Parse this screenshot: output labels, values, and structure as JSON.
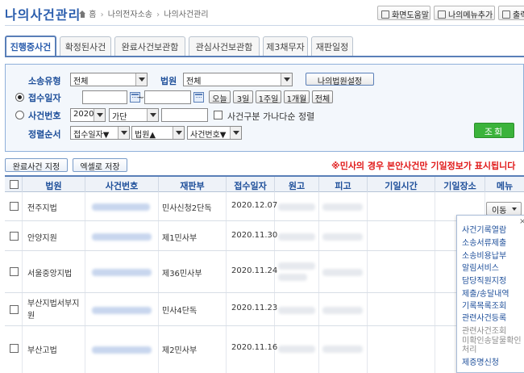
{
  "header": {
    "title": "나의사건관리",
    "breadcrumb": [
      "홈",
      "나의전자소송",
      "나의사건관리"
    ],
    "buttons": {
      "help": "화면도움말",
      "add_menu": "나의메뉴추가",
      "print": "출력"
    }
  },
  "tabs": [
    {
      "label": "진행중사건",
      "active": true
    },
    {
      "label": "확정된사건",
      "active": false
    },
    {
      "label": "완료사건보관함",
      "active": false
    },
    {
      "label": "관심사건보관함",
      "active": false
    },
    {
      "label": "제3채무자",
      "active": false
    },
    {
      "label": "재판일정",
      "active": false
    }
  ],
  "search": {
    "type_label": "소송유형",
    "type_value": "전체",
    "court_label": "법원",
    "court_value": "전체",
    "court_setting_button": "나의법원설정",
    "date_label": "접수일자",
    "date_from": "",
    "date_to": "",
    "date_range_sep": "~",
    "date_buttons": [
      "오늘",
      "3일",
      "1주일",
      "1개월",
      "전체"
    ],
    "case_label": "사건번호",
    "case_year": "2020",
    "case_type": "가단",
    "case_number": "",
    "multi_case_label": "사건구분 가나다순 정렬",
    "sort_label": "정렬순서",
    "sort_options": [
      "접수일자▼",
      "법원▲",
      "사건번호▼"
    ],
    "search_button": "조회"
  },
  "actions": {
    "complete_button": "완료사건 지정",
    "excel_button": "엑셀로 저장",
    "notice": "※민사의 경우 본안사건만 기일정보가 표시됩니다"
  },
  "table": {
    "headers": [
      "법원",
      "사건번호",
      "재판부",
      "접수일자",
      "원고",
      "피고",
      "기일시간",
      "기일장소",
      "메뉴"
    ],
    "rows": [
      {
        "court": "전주지법",
        "division": "민사신청2단독",
        "date": "2020.12.07"
      },
      {
        "court": "안양지원",
        "division": "제1민사부",
        "date": "2020.11.30"
      },
      {
        "court": "서울중앙지법",
        "division": "제36민사부",
        "date": "2020.11.24"
      },
      {
        "court": "부산지법서부지원",
        "division": "민사4단독",
        "date": "2020.11.23"
      },
      {
        "court": "부산고법",
        "division": "제2민사부",
        "date": "2020.11.16"
      }
    ],
    "move_button": "이동"
  },
  "popup_menu": {
    "close": "×",
    "items": [
      {
        "label": "사건기록열람",
        "enabled": true
      },
      {
        "label": "소송서류제출",
        "enabled": true
      },
      {
        "label": "소송비용납부",
        "enabled": true
      },
      {
        "label": "알림서비스",
        "enabled": true
      },
      {
        "label": "담당직원지정",
        "enabled": true
      },
      {
        "label": "제출/송달내역",
        "enabled": true
      },
      {
        "label": "기록목록조회",
        "enabled": true
      },
      {
        "label": "관련사건등록",
        "enabled": true
      },
      {
        "label": "관련사건조회",
        "enabled": false
      },
      {
        "label": "미확인송달물확인처리",
        "enabled": false
      },
      {
        "label": "제증명신청",
        "enabled": true
      }
    ]
  },
  "colors": {
    "brand_blue": "#2a5dad",
    "label_blue": "#1e4f9a",
    "notice_red": "#e01919",
    "search_green": "#3bb33b"
  }
}
